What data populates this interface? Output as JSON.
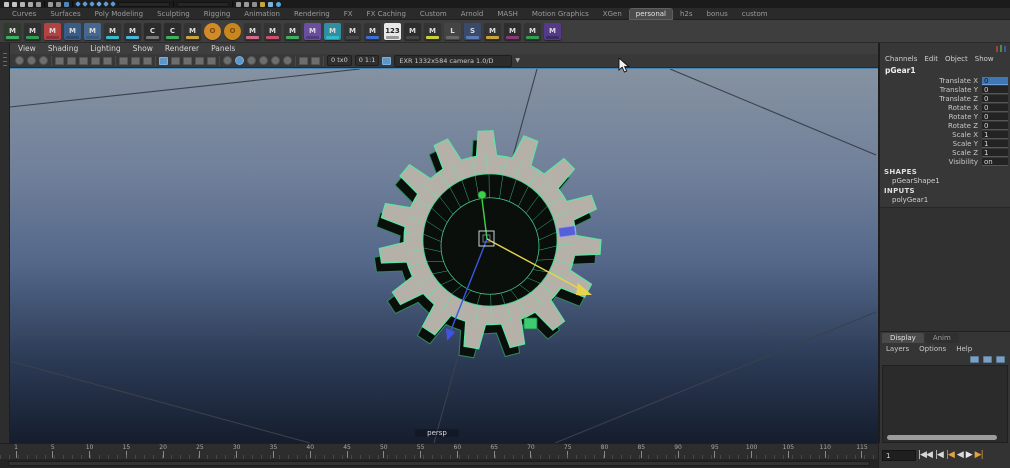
{
  "app": {
    "accent": "#4e86b8",
    "wire_green": "#5fe3a4",
    "amber": "#e2a23c"
  },
  "status_line": {
    "icons": [
      {
        "k": "sq",
        "c": "#c4c4c4"
      },
      {
        "k": "sq",
        "c": "#c4c4c4"
      },
      {
        "k": "sq",
        "c": "#b4b4b4"
      },
      {
        "k": "sq",
        "c": "#a8a8a8"
      },
      {
        "k": "sq",
        "c": "#9a9a9a"
      },
      {
        "k": "sep"
      },
      {
        "k": "sq",
        "c": "#9a9a9a"
      },
      {
        "k": "sq",
        "c": "#8f8f8f"
      },
      {
        "k": "sq",
        "c": "#4e86b8"
      },
      {
        "k": "sep"
      },
      {
        "k": "dm",
        "c": "#5d9bd3"
      },
      {
        "k": "dm",
        "c": "#5d9bd3"
      },
      {
        "k": "dm",
        "c": "#5d9bd3"
      },
      {
        "k": "dm",
        "c": "#6aa7dc"
      },
      {
        "k": "dm",
        "c": "#5d9bd3"
      },
      {
        "k": "dm",
        "c": "#5d9bd3"
      },
      {
        "k": "fld"
      },
      {
        "k": "sep"
      },
      {
        "k": "fld"
      },
      {
        "k": "sep"
      },
      {
        "k": "sq",
        "c": "#9a9a9a"
      },
      {
        "k": "sq",
        "c": "#9a9a9a"
      },
      {
        "k": "sq",
        "c": "#8f8f8f"
      },
      {
        "k": "sq",
        "c": "#c9a23a"
      },
      {
        "k": "sq",
        "c": "#7fb0d8"
      },
      {
        "k": "dot",
        "c": "#57a8e0"
      }
    ]
  },
  "shelf_tabs": {
    "tabs": [
      {
        "label": "Curves"
      },
      {
        "label": "Surfaces"
      },
      {
        "label": "Poly Modeling"
      },
      {
        "label": "Sculpting"
      },
      {
        "label": "Rigging"
      },
      {
        "label": "Animation"
      },
      {
        "label": "Rendering"
      },
      {
        "label": "FX"
      },
      {
        "label": "FX Caching"
      },
      {
        "label": "Custom"
      },
      {
        "label": "Arnold"
      },
      {
        "label": "MASH"
      },
      {
        "label": "Motion Graphics"
      },
      {
        "label": "XGen"
      },
      {
        "label": "personal",
        "active": true
      },
      {
        "label": "h2s"
      },
      {
        "label": "bonus"
      },
      {
        "label": "custom"
      }
    ]
  },
  "shelf": {
    "buttons": [
      {
        "bg": "#2e3b2e",
        "glyph": "M",
        "badge": "#3fae5f"
      },
      {
        "bg": "#303030",
        "glyph": "M",
        "badge": "#2f9e52"
      },
      {
        "bg": "#b34242",
        "glyph": "M",
        "badge": "#8c2f3a"
      },
      {
        "bg": "#3a5d86",
        "glyph": "M",
        "badge": "#2c4a6e"
      },
      {
        "bg": "#46688f",
        "glyph": "M",
        "badge": "#365a80"
      },
      {
        "bg": "#333333",
        "glyph": "M",
        "badge": "#37b9c9"
      },
      {
        "bg": "#2f2f2f",
        "glyph": "M",
        "badge": "#49b3d8"
      },
      {
        "bg": "#2b2b2b",
        "glyph": "C",
        "badge": "#777777"
      },
      {
        "bg": "#2b2b2b",
        "glyph": "C",
        "badge": "#3fae5f"
      },
      {
        "bg": "#333333",
        "glyph": "M",
        "badge": "#c9a23a"
      },
      {
        "shape": "circle",
        "bg": "#d08a2a",
        "glyph": "O",
        "glyph_color": "#7a4a12"
      },
      {
        "shape": "circle",
        "bg": "#c8861f",
        "glyph": "O",
        "glyph_color": "#7a4a12"
      },
      {
        "bg": "#333333",
        "glyph": "M",
        "badge": "#d06a8a"
      },
      {
        "bg": "#333333",
        "glyph": "M",
        "badge": "#cc4f6b"
      },
      {
        "bg": "#333333",
        "glyph": "M",
        "badge": "#3fae5f"
      },
      {
        "bg": "#6a4fa0",
        "glyph": "M",
        "badge": "#503a80"
      },
      {
        "bg": "#2f8ea0",
        "glyph": "M",
        "badge": "#30b9c9"
      },
      {
        "bg": "#333333",
        "glyph": "M",
        "badge": "#444444"
      },
      {
        "bg": "#333333",
        "glyph": "M",
        "badge": "#3a6fd0"
      },
      {
        "bg": "#e8e8e8",
        "glyph": "123",
        "glyph_color": "#222222",
        "badge": "#999999"
      },
      {
        "bg": "#2d2d2d",
        "glyph": "M",
        "badge": "#444444"
      },
      {
        "bg": "#333333",
        "glyph": "M",
        "badge": "#c9d03a"
      },
      {
        "bg": "#444444",
        "glyph": "L",
        "badge": "#666666"
      },
      {
        "bg": "#3a4a6a",
        "glyph": "S",
        "badge": "#5a7ab8"
      },
      {
        "bg": "#333333",
        "glyph": "M",
        "badge": "#c9a23a"
      },
      {
        "bg": "#2d2d2d",
        "glyph": "M",
        "badge": "#883a78"
      },
      {
        "bg": "#333333",
        "glyph": "M",
        "badge": "#2f9e52"
      },
      {
        "bg": "#553a8a",
        "glyph": "M",
        "badge": "#3a2a66"
      }
    ]
  },
  "panel_menubar": {
    "items": [
      "View",
      "Shading",
      "Lighting",
      "Show",
      "Renderer",
      "Panels"
    ]
  },
  "viewport_toolbar": {
    "items": [
      {
        "t": "c"
      },
      {
        "t": "c"
      },
      {
        "t": "c"
      },
      {
        "t": "sep"
      },
      {
        "t": "s"
      },
      {
        "t": "s"
      },
      {
        "t": "s"
      },
      {
        "t": "s"
      },
      {
        "t": "s"
      },
      {
        "t": "sep"
      },
      {
        "t": "s"
      },
      {
        "t": "s"
      },
      {
        "t": "s"
      },
      {
        "t": "sep"
      },
      {
        "t": "s",
        "active": true
      },
      {
        "t": "s"
      },
      {
        "t": "s"
      },
      {
        "t": "s"
      },
      {
        "t": "s"
      },
      {
        "t": "sep"
      },
      {
        "t": "c"
      },
      {
        "t": "c",
        "active": true
      },
      {
        "t": "c"
      },
      {
        "t": "c"
      },
      {
        "t": "c"
      },
      {
        "t": "c"
      },
      {
        "t": "sep"
      },
      {
        "t": "s"
      },
      {
        "t": "s"
      },
      {
        "t": "sep"
      },
      {
        "t": "chip",
        "label": "0 tx0"
      },
      {
        "t": "chip",
        "label": "0 1:1"
      },
      {
        "t": "s",
        "active": true
      },
      {
        "t": "dd",
        "label": "EXR 1332x584 camera 1.0/D"
      },
      {
        "t": "car",
        "label": "▼"
      }
    ]
  },
  "viewport": {
    "camera_label": "persp"
  },
  "scene": {
    "gear": {
      "teeth": 15,
      "face_color": "#b6b1a8",
      "side_color": "#0a0f0b",
      "wire_color": "#5fe3a4"
    },
    "manipulator": {
      "x_color": "#e8d44d",
      "y_color": "#3fd14a",
      "z_color": "#3c55e2"
    }
  },
  "channel_box": {
    "menu": [
      "Channels",
      "Edit",
      "Object",
      "Show"
    ],
    "object_name": "pGear1",
    "channels": [
      {
        "label": "Translate X",
        "value": "0",
        "selected": true
      },
      {
        "label": "Translate Y",
        "value": "0"
      },
      {
        "label": "Translate Z",
        "value": "0"
      },
      {
        "label": "Rotate X",
        "value": "0"
      },
      {
        "label": "Rotate Y",
        "value": "0"
      },
      {
        "label": "Rotate Z",
        "value": "0"
      },
      {
        "label": "Scale X",
        "value": "1"
      },
      {
        "label": "Scale Y",
        "value": "1"
      },
      {
        "label": "Scale Z",
        "value": "1"
      },
      {
        "label": "Visibility",
        "value": "on"
      }
    ],
    "shapes_header": "SHAPES",
    "shape_name": "pGearShape1",
    "inputs_header": "INPUTS",
    "input_name": "polyGear1"
  },
  "layer_editor": {
    "tabs": [
      {
        "label": "Display",
        "active": true
      },
      {
        "label": "Anim",
        "active": false
      }
    ],
    "menu": [
      "Layers",
      "Options",
      "Help"
    ]
  },
  "timeline": {
    "ticks": [
      "1",
      "5",
      "10",
      "15",
      "20",
      "25",
      "30",
      "35",
      "40",
      "45",
      "50",
      "55",
      "60",
      "65",
      "70",
      "75",
      "80",
      "85",
      "90",
      "95",
      "100",
      "105",
      "110",
      "115"
    ]
  },
  "playback": {
    "current_frame": "1",
    "buttons": [
      {
        "name": "go-to-start",
        "glyph": "|◀◀",
        "color": "#d8d8d8"
      },
      {
        "name": "step-back-frame",
        "glyph": "|◀",
        "color": "#d8d8d8"
      },
      {
        "name": "step-back-key",
        "glyph": "|◀",
        "color": "#e2a23c"
      },
      {
        "name": "play-backwards",
        "glyph": "◀",
        "color": "#d8d8d8"
      },
      {
        "name": "play-forward",
        "glyph": "▶",
        "color": "#e8e8e8"
      },
      {
        "name": "step-forward-key",
        "glyph": "▶|",
        "color": "#e2a23c"
      }
    ]
  }
}
